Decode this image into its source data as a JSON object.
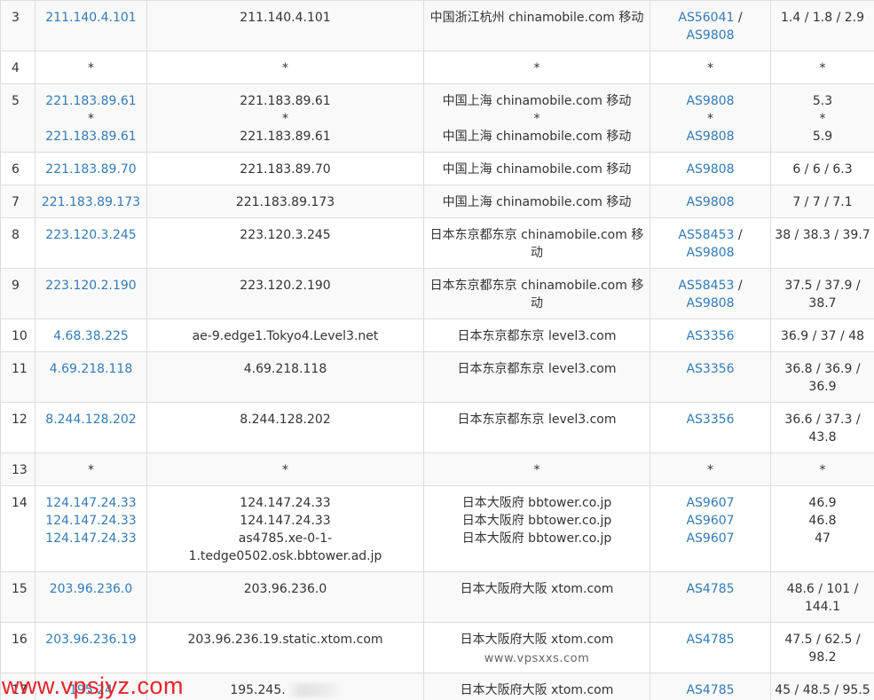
{
  "rows": [
    {
      "hop": "3",
      "ip": [
        "211.140.4.101"
      ],
      "host": [
        "211.140.4.101"
      ],
      "geo": [
        "中国浙江杭州 chinamobile.com 移动"
      ],
      "asn": [
        [
          "AS56041",
          " /"
        ],
        [
          "AS9808",
          ""
        ]
      ],
      "rtt": [
        "1.4 / 1.8 / 2.9"
      ]
    },
    {
      "hop": "4",
      "ip": [
        "*"
      ],
      "host": [
        "*"
      ],
      "geo": [
        "*"
      ],
      "asn": [
        [
          "*",
          ""
        ]
      ],
      "rtt": [
        "*"
      ],
      "plain": true
    },
    {
      "hop": "5",
      "ip": [
        "221.183.89.61",
        "*",
        "221.183.89.61"
      ],
      "host": [
        "221.183.89.61",
        "*",
        "221.183.89.61"
      ],
      "geo": [
        "中国上海 chinamobile.com 移动",
        "*",
        "中国上海 chinamobile.com 移动"
      ],
      "asn": [
        [
          "AS9808",
          ""
        ],
        [
          "*",
          ""
        ],
        [
          "AS9808",
          ""
        ]
      ],
      "rtt": [
        "5.3",
        "*",
        "5.9"
      ]
    },
    {
      "hop": "6",
      "ip": [
        "221.183.89.70"
      ],
      "host": [
        "221.183.89.70"
      ],
      "geo": [
        "中国上海 chinamobile.com 移动"
      ],
      "asn": [
        [
          "AS9808",
          ""
        ]
      ],
      "rtt": [
        "6 / 6 / 6.3"
      ]
    },
    {
      "hop": "7",
      "ip": [
        "221.183.89.173"
      ],
      "host": [
        "221.183.89.173"
      ],
      "geo": [
        "中国上海 chinamobile.com 移动"
      ],
      "asn": [
        [
          "AS9808",
          ""
        ]
      ],
      "rtt": [
        "7 / 7 / 7.1"
      ]
    },
    {
      "hop": "8",
      "ip": [
        "223.120.3.245"
      ],
      "host": [
        "223.120.3.245"
      ],
      "geo": [
        "日本东京都东京 chinamobile.com 移动"
      ],
      "asn": [
        [
          "AS58453",
          " /"
        ],
        [
          "AS9808",
          ""
        ]
      ],
      "rtt": [
        "38 / 38.3 / 39.7"
      ]
    },
    {
      "hop": "9",
      "ip": [
        "223.120.2.190"
      ],
      "host": [
        "223.120.2.190"
      ],
      "geo": [
        "日本东京都东京 chinamobile.com 移动"
      ],
      "asn": [
        [
          "AS58453",
          " /"
        ],
        [
          "AS9808",
          ""
        ]
      ],
      "rtt": [
        "37.5 / 37.9 / 38.7"
      ]
    },
    {
      "hop": "10",
      "ip": [
        "4.68.38.225"
      ],
      "host": [
        "ae-9.edge1.Tokyo4.Level3.net"
      ],
      "geo": [
        "日本东京都东京 level3.com"
      ],
      "asn": [
        [
          "AS3356",
          ""
        ]
      ],
      "rtt": [
        "36.9 / 37 / 48"
      ]
    },
    {
      "hop": "11",
      "ip": [
        "4.69.218.118"
      ],
      "host": [
        "4.69.218.118"
      ],
      "geo": [
        "日本东京都东京 level3.com"
      ],
      "asn": [
        [
          "AS3356",
          ""
        ]
      ],
      "rtt": [
        "36.8 / 36.9 / 36.9"
      ]
    },
    {
      "hop": "12",
      "ip": [
        "8.244.128.202"
      ],
      "host": [
        "8.244.128.202"
      ],
      "geo": [
        "日本东京都东京 level3.com"
      ],
      "asn": [
        [
          "AS3356",
          ""
        ]
      ],
      "rtt": [
        "36.6 / 37.3 / 43.8"
      ]
    },
    {
      "hop": "13",
      "ip": [
        "*"
      ],
      "host": [
        "*"
      ],
      "geo": [
        "*"
      ],
      "asn": [
        [
          "*",
          ""
        ]
      ],
      "rtt": [
        "*"
      ],
      "plain": true
    },
    {
      "hop": "14",
      "ip": [
        "124.147.24.33",
        "124.147.24.33",
        "124.147.24.33"
      ],
      "host": [
        "124.147.24.33",
        "124.147.24.33",
        "as4785.xe-0-1-1.tedge0502.osk.bbtower.ad.jp"
      ],
      "geo": [
        "日本大阪府 bbtower.co.jp",
        "日本大阪府 bbtower.co.jp",
        "日本大阪府 bbtower.co.jp"
      ],
      "asn": [
        [
          "AS9607",
          ""
        ],
        [
          "AS9607",
          ""
        ],
        [
          "AS9607",
          ""
        ]
      ],
      "rtt": [
        "46.9",
        "46.8",
        "47"
      ]
    },
    {
      "hop": "15",
      "ip": [
        "203.96.236.0"
      ],
      "host": [
        "203.96.236.0"
      ],
      "geo": [
        "日本大阪府大阪 xtom.com"
      ],
      "asn": [
        [
          "AS4785",
          ""
        ]
      ],
      "rtt": [
        "48.6 / 101 / 144.1"
      ]
    },
    {
      "hop": "16",
      "ip": [
        "203.96.236.19"
      ],
      "host": [
        "203.96.236.19.static.xtom.com"
      ],
      "geo": [
        "日本大阪府大阪 xtom.com"
      ],
      "asn": [
        [
          "AS4785",
          ""
        ]
      ],
      "rtt": [
        "47.5 / 62.5 / 98.2"
      ],
      "watermark": "www.vpsxxs.com"
    },
    {
      "hop": "17",
      "ip": [
        "195.24"
      ],
      "host": [
        "195.245."
      ],
      "geo": [
        "日本大阪府大阪 xtom.com"
      ],
      "asn": [
        [
          "AS4785",
          ""
        ]
      ],
      "rtt": [
        "45 / 48.5 / 95.5"
      ],
      "blurred": true
    }
  ],
  "watermark_main": "www.vpsjyz.com",
  "colors": {
    "link": "#337ab7",
    "border": "#dddddd",
    "stripe": "#f9f9f9",
    "watermark": "#e8232b"
  }
}
